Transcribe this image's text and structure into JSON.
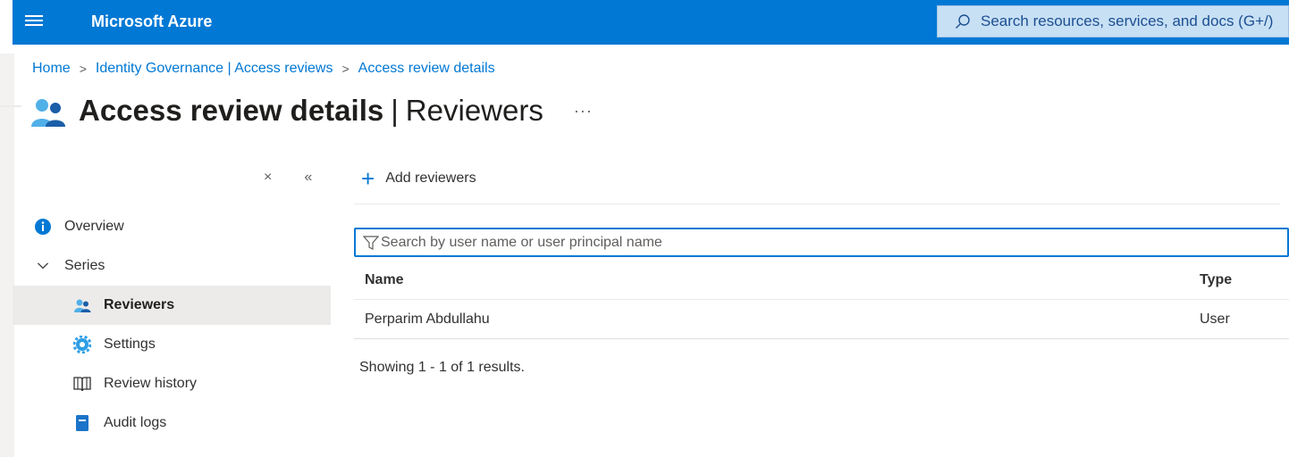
{
  "topbar": {
    "brand": "Microsoft Azure",
    "search_placeholder": "Search resources, services, and docs (G+/)",
    "accent": "#0078d4"
  },
  "breadcrumb": {
    "items": [
      "Home",
      "Identity Governance | Access reviews",
      "Access review details"
    ],
    "separator": ">"
  },
  "page": {
    "title_main": "Access review details",
    "title_pipe": "|",
    "title_sub": "Reviewers",
    "more_label": "···"
  },
  "sidebar": {
    "close_label": "×",
    "collapse_label": "«",
    "items": [
      {
        "label": "Overview",
        "icon": "info-icon"
      },
      {
        "label": "Series",
        "icon": "chevron-down-icon"
      },
      {
        "label": "Reviewers",
        "icon": "people-icon",
        "active": true
      },
      {
        "label": "Settings",
        "icon": "gear-icon"
      },
      {
        "label": "Review history",
        "icon": "book-icon"
      },
      {
        "label": "Audit logs",
        "icon": "log-icon"
      }
    ]
  },
  "toolbar": {
    "add_label": "Add reviewers",
    "add_icon": "+"
  },
  "filter": {
    "placeholder": "Search by user name or user principal name",
    "value": ""
  },
  "table": {
    "columns": [
      "Name",
      "Type"
    ],
    "rows": [
      [
        "Perparim Abdullahu",
        "User"
      ]
    ]
  },
  "status": {
    "results_text": "Showing 1 - 1 of 1 results."
  }
}
